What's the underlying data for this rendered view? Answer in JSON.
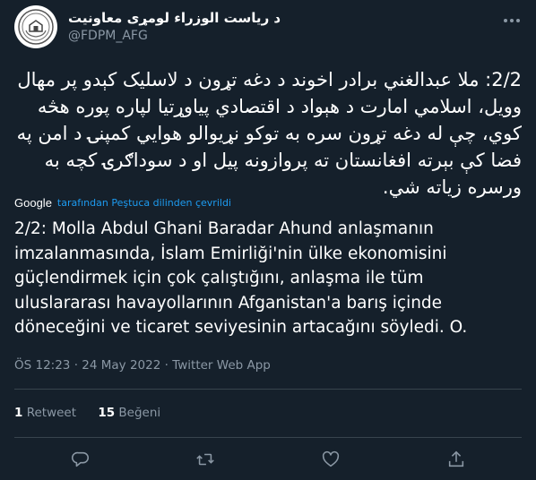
{
  "author": {
    "display_name": "د ریاست الوزراء لومړی معاونیت",
    "handle": "@FDPM_AFG"
  },
  "tweet": {
    "text": "2/2: ملا عبدالغني برادر اخوند د دغه تړون د لاسلیک کېدو پر مهال وویل، اسلامي امارت د هېواد د اقتصادي پیاوړتیا لپاره پوره هڅه کوي، چې له دغه تړون سره به توکو نړیوالو هوایي کمپنۍ د امن په فضا کې بېرته افغانستان ته پروازونه پیل او د سوداګرۍ کچه به ورسره زیاته شي.",
    "translate_by": "Google",
    "translate_label": "tarafından Peştuca dilinden çevrildi",
    "translated_text": "2/2: Molla Abdul Ghani Baradar Ahund anlaşmanın imzalanmasında, İslam Emirliği'nin ülke ekonomisini güçlendirmek için çok çalıştığını, anlaşma ile tüm uluslararası havayollarının Afganistan'a barış içinde döneceğini ve ticaret seviyesinin artacağını söyledi. O."
  },
  "meta": {
    "time": "ÖS 12:23",
    "date": "24 May 2022",
    "source": "Twitter Web App",
    "separator": "·"
  },
  "stats": {
    "retweets_count": "1",
    "retweets_label": "Retweet",
    "likes_count": "15",
    "likes_label": "Beğeni"
  },
  "icons": {
    "more": "more-horizontal-icon",
    "reply": "reply-icon",
    "retweet": "retweet-icon",
    "like": "heart-icon",
    "share": "share-icon"
  },
  "colors": {
    "background": "#15202b",
    "secondary_text": "#8b98a5",
    "link": "#1d9bf0",
    "divider": "#38444d"
  }
}
